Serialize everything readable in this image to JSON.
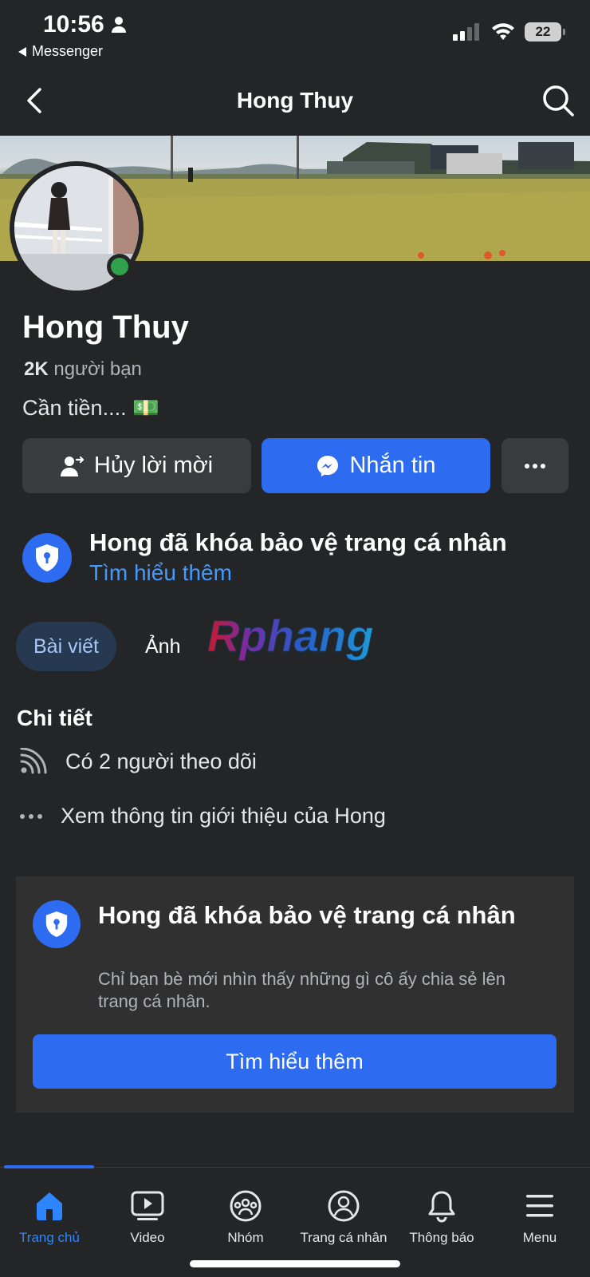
{
  "status_bar": {
    "time": "10:56",
    "back_app": "Messenger",
    "battery": "22"
  },
  "header": {
    "title": "Hong Thuy"
  },
  "profile": {
    "name": "Hong Thuy",
    "friends_count": "2K",
    "friends_label": "người bạn",
    "bio": "Cần tiền.... 💵"
  },
  "actions": {
    "cancel_request": "Hủy lời mời",
    "message": "Nhắn tin"
  },
  "lock_notice": {
    "title": "Hong đã khóa bảo vệ trang cá nhân",
    "link": "Tìm hiểu thêm"
  },
  "tabs": [
    {
      "label": "Bài viết",
      "active": true
    },
    {
      "label": "Ảnh",
      "active": false
    }
  ],
  "watermark": "Rphang",
  "details": {
    "title": "Chi tiết",
    "followers": "Có 2 người theo dõi",
    "about": "Xem thông tin giới thiệu của Hong"
  },
  "lock_card": {
    "title": "Hong đã khóa bảo vệ trang cá nhân",
    "subtitle": "Chỉ bạn bè mới nhìn thấy những gì cô ấy chia sẻ lên trang cá nhân.",
    "button": "Tìm hiểu thêm"
  },
  "bottom_nav": [
    {
      "label": "Trang chủ",
      "icon": "home-icon",
      "active": true
    },
    {
      "label": "Video",
      "icon": "video-icon",
      "active": false
    },
    {
      "label": "Nhóm",
      "icon": "groups-icon",
      "active": false
    },
    {
      "label": "Trang cá nhân",
      "icon": "profile-icon",
      "active": false
    },
    {
      "label": "Thông báo",
      "icon": "bell-icon",
      "active": false
    },
    {
      "label": "Menu",
      "icon": "menu-icon",
      "active": false
    }
  ],
  "colors": {
    "accent": "#2d6cf0",
    "link": "#4599ff",
    "online": "#31a24c",
    "background": "#242526"
  }
}
